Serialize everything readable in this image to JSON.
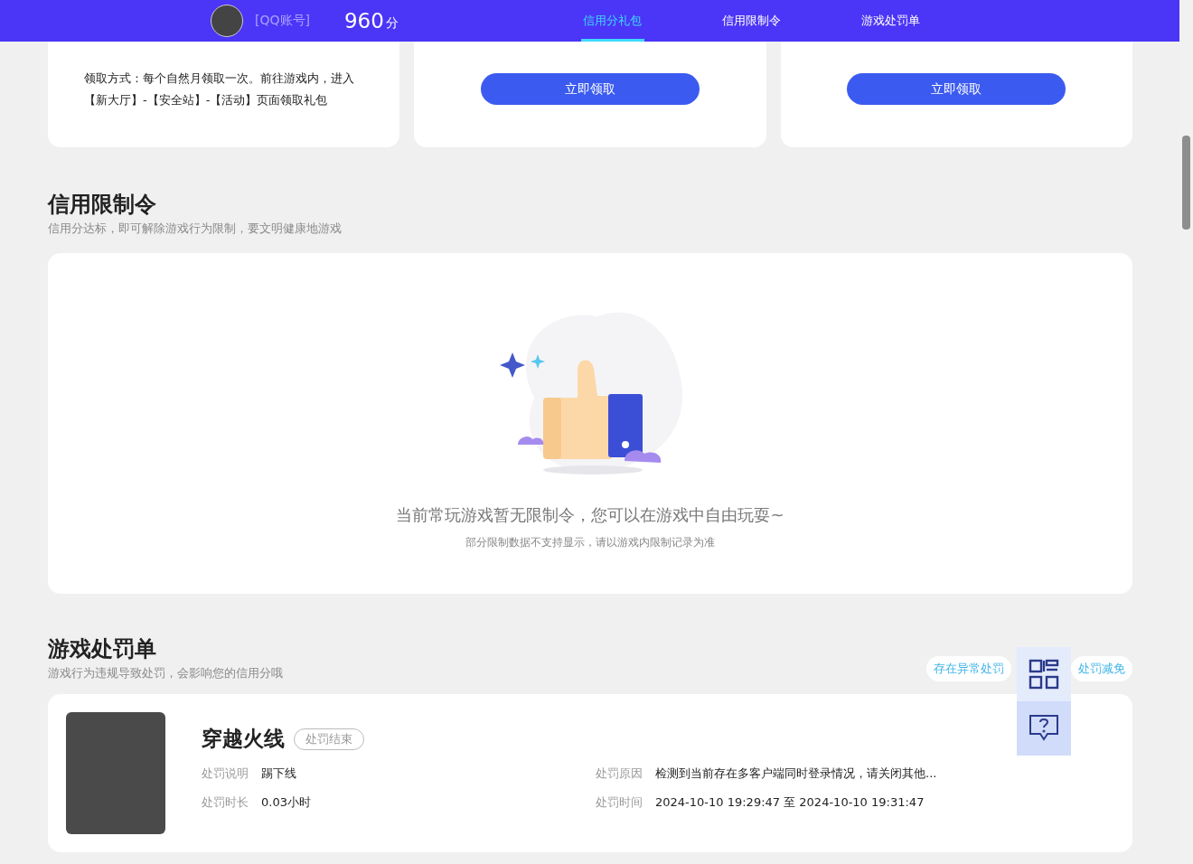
{
  "nav": {
    "account": "[QQ账号]",
    "score": "960",
    "score_unit": "分",
    "tabs": [
      {
        "label": "信用分礼包",
        "selected": true
      },
      {
        "label": "信用限制令",
        "selected": false
      },
      {
        "label": "游戏处罚单",
        "selected": false
      }
    ]
  },
  "gift_cards": [
    {
      "kind": "text",
      "description": "领取方式：每个自然月领取一次。前往游戏内，进入【新大厅】-【安全站】-【活动】页面领取礼包"
    },
    {
      "kind": "button",
      "button": "立即领取"
    },
    {
      "kind": "button",
      "button": "立即领取"
    }
  ],
  "restriction": {
    "title": "信用限制令",
    "subtitle": "信用分达标，即可解除游戏行为限制，要文明健康地游戏",
    "empty_message": "当前常玩游戏暂无限制令，您可以在游戏中自由玩耍~",
    "empty_note": "部分限制数据不支持显示，请以游戏内限制记录为准"
  },
  "penalties": {
    "title": "游戏处罚单",
    "subtitle": "游戏行为违规导致处罚，会影响您的信用分哦",
    "filters": [
      "存在异常处罚",
      "处罚减免"
    ],
    "items": [
      {
        "game": "穿越火线",
        "status": "处罚结束",
        "fields": [
          {
            "label": "处罚说明",
            "value": "踢下线"
          },
          {
            "label": "处罚原因",
            "value": "检测到当前存在多客户端同时登录情况，请关闭其他..."
          },
          {
            "label": "处罚时长",
            "value": "0.03小时"
          },
          {
            "label": "处罚时间",
            "value": "2024-10-10 19:29:47 至 2024-10-10 19:31:47"
          }
        ]
      }
    ]
  }
}
